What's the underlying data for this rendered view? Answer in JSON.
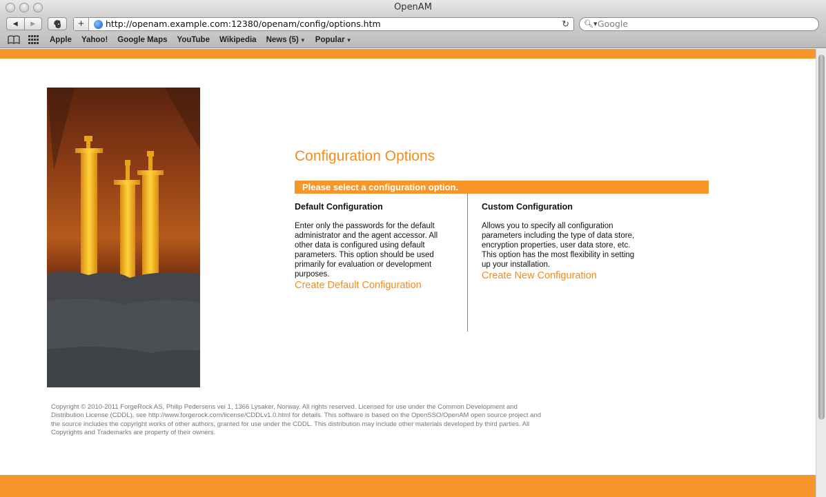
{
  "window": {
    "title": "OpenAM"
  },
  "toolbar": {
    "back_icon": "back-arrow-icon",
    "forward_icon": "forward-arrow-icon",
    "url": "http://openam.example.com:12380/openam/config/options.htm",
    "search_placeholder": "Google"
  },
  "bookmarks": {
    "items": [
      {
        "label": "Apple"
      },
      {
        "label": "Yahoo!"
      },
      {
        "label": "Google Maps"
      },
      {
        "label": "YouTube"
      },
      {
        "label": "Wikipedia"
      },
      {
        "label": "News (5)"
      },
      {
        "label": "Popular"
      }
    ]
  },
  "page": {
    "heading": "Configuration Options",
    "prompt": "Please select a configuration option.",
    "default": {
      "title": "Default Configuration",
      "description": "Enter only the passwords for the default administrator and the agent accessor. All other data is configured using default parameters. This option should be used primarily for evaluation or development purposes.",
      "link": "Create Default Configuration"
    },
    "custom": {
      "title": "Custom Configuration",
      "description": "Allows you to specify all configuration parameters including the type of data store, encryption properties, user data store, etc. This option has the most flexibility in setting up your installation.",
      "link": "Create New Configuration"
    },
    "copyright": "Copyright © 2010-2011 ForgeRock AS, Philip Pedersens vei 1, 1366 Lysaker, Norway. All rights reserved. Licensed for use under the Common Development and Distribution License (CDDL), see http://www.forgerock.com/license/CDDLv1.0.html for details. This software is based on the OpenSSO/OpenAM open source project and the source includes the copyright works of other authors, granted for use under the CDDL. This distribution may include other materials developed by third parties. All Copyrights and Trademarks are property of their owners."
  },
  "colors": {
    "accent": "#f7962b",
    "link": "#f28c1c"
  }
}
